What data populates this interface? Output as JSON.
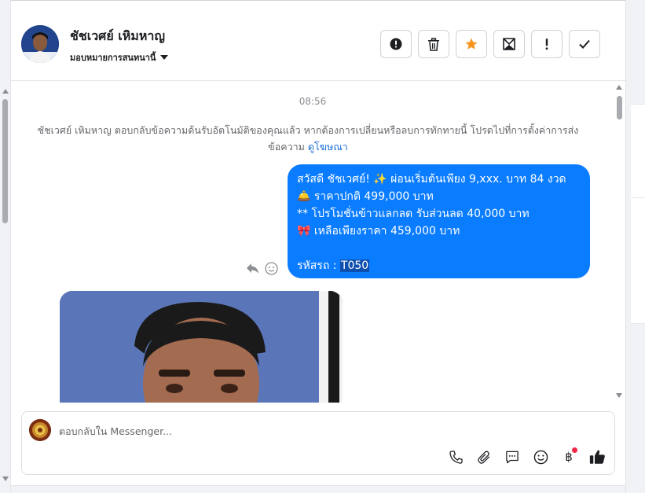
{
  "header": {
    "contact_name": "ชัชเวศย์ เหิมหาญ",
    "assign_label": "มอบหมายการสนทนานี้",
    "actions": [
      {
        "name": "report-spam-button",
        "icon": "alert-circle-icon"
      },
      {
        "name": "delete-button",
        "icon": "trash-icon"
      },
      {
        "name": "star-button",
        "icon": "star-icon"
      },
      {
        "name": "mark-unread-button",
        "icon": "envelope-icon"
      },
      {
        "name": "mark-follow-up-button",
        "icon": "exclamation-icon"
      },
      {
        "name": "mark-done-button",
        "icon": "check-icon"
      }
    ]
  },
  "chat": {
    "time": "08:56",
    "system_message": "ชัชเวศย์ เหิมหาญ ตอบกลับข้อความด้นรับอัตโนมัติของคุณแล้ว หากต้องการเปลี่ยนหรือลบการทักทายนี้ โปรดไปที่การตั้งค่าการส่งข้อความ",
    "system_link": "ดูโฆษณา",
    "bubble": {
      "line1": "สวัสดี ชัชเวศย์! ✨  ผ่อนเริ่มต้นเพียง 9,xxx. บาท 84 งวด",
      "line2": "🛎️ ราคาปกติ 499,000 บาท",
      "line3": "** โปรโมชั่นข้าวแลกลด รับส่วนลด 40,000 บาท",
      "line4": "🎀  เหลือเพียงราคา 459,000 บาท",
      "code_label": "รหัสรถ : ",
      "code_value": "T050"
    }
  },
  "composer": {
    "placeholder": "ตอบกลับใน Messenger...",
    "baht_symbol": "฿"
  },
  "colors": {
    "accent": "#0a7cff",
    "star": "#f7931e",
    "link": "#1c6fd6"
  }
}
